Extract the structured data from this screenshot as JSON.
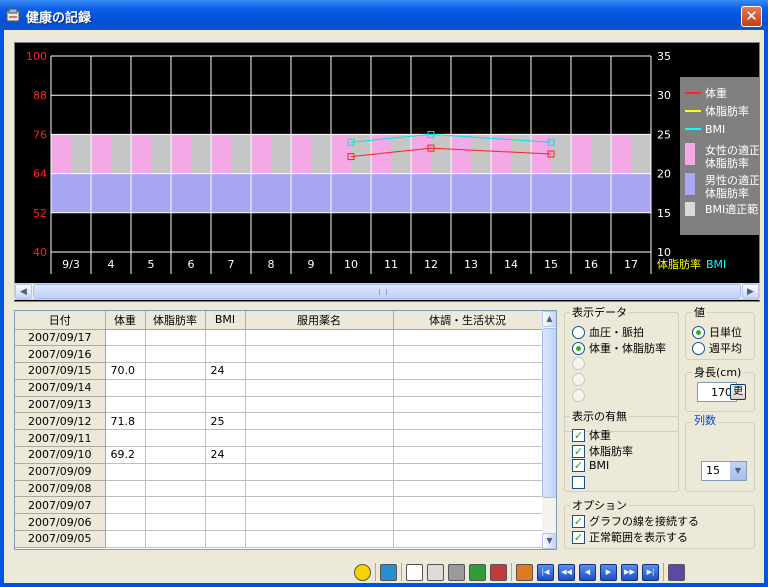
{
  "window": {
    "title": "健康の記録",
    "close_label": "✕"
  },
  "chart": {
    "left_ticks": [
      "100",
      "88",
      "76",
      "64",
      "52",
      "40"
    ],
    "right_ticks": [
      "35",
      "30",
      "25",
      "20",
      "15",
      "10"
    ],
    "x_labels": [
      "9/3",
      "4",
      "5",
      "6",
      "7",
      "8",
      "9",
      "10",
      "11",
      "12",
      "13",
      "14",
      "15",
      "16",
      "17"
    ],
    "bottom_right_label_1": "体脂肪率",
    "bottom_right_label_2": "BMI",
    "legend": [
      {
        "label": "体重",
        "color": "#ff2020",
        "kind": "line"
      },
      {
        "label": "体脂肪率",
        "color": "#ffff00",
        "kind": "line"
      },
      {
        "label": "BMI",
        "color": "#00ffff",
        "kind": "line"
      },
      {
        "label": "女性の適正",
        "label2": "体脂肪率",
        "color": "#f3a9e6",
        "kind": "box"
      },
      {
        "label": "男性の適正",
        "label2": "体脂肪率",
        "color": "#aaa9f3",
        "kind": "box"
      },
      {
        "label": "BMI適正範囲",
        "color": "#d9d9d9",
        "kind": "box"
      }
    ],
    "colors": {
      "weight": "#ff2020",
      "bmi": "#00e5e5",
      "female": "#f3a9e6",
      "male": "#a8a6f0",
      "bmi_band": "#c6c6c6"
    }
  },
  "chart_data": {
    "type": "line",
    "categories": [
      "9/3",
      "4",
      "5",
      "6",
      "7",
      "8",
      "9",
      "10",
      "11",
      "12",
      "13",
      "14",
      "15",
      "16",
      "17"
    ],
    "series": [
      {
        "name": "体重",
        "axis": "left",
        "values": [
          null,
          null,
          null,
          null,
          null,
          null,
          null,
          69.2,
          null,
          71.8,
          null,
          null,
          70.0,
          null,
          null
        ]
      },
      {
        "name": "BMI",
        "axis": "right",
        "values": [
          null,
          null,
          null,
          null,
          null,
          null,
          null,
          24,
          null,
          25,
          null,
          null,
          24,
          null,
          null
        ]
      }
    ],
    "ylim_left": [
      40,
      100
    ],
    "ylim_right": [
      10,
      35
    ],
    "bands": {
      "female_body_fat": [
        64,
        76
      ],
      "male_body_fat": [
        52,
        64
      ],
      "bmi_normal": [
        18.5,
        25
      ]
    },
    "grid": true,
    "legend_position": "right"
  },
  "table": {
    "headers": [
      "日付",
      "体重",
      "体脂肪率",
      "BMI",
      "服用薬名",
      "体調・生活状況"
    ],
    "rows": [
      [
        "2007/09/17",
        "",
        "",
        "",
        "",
        ""
      ],
      [
        "2007/09/16",
        "",
        "",
        "",
        "",
        ""
      ],
      [
        "2007/09/15",
        "70.0",
        "",
        "24",
        "",
        ""
      ],
      [
        "2007/09/14",
        "",
        "",
        "",
        "",
        ""
      ],
      [
        "2007/09/13",
        "",
        "",
        "",
        "",
        ""
      ],
      [
        "2007/09/12",
        "71.8",
        "",
        "25",
        "",
        ""
      ],
      [
        "2007/09/11",
        "",
        "",
        "",
        "",
        ""
      ],
      [
        "2007/09/10",
        "69.2",
        "",
        "24",
        "",
        ""
      ],
      [
        "2007/09/09",
        "",
        "",
        "",
        "",
        ""
      ],
      [
        "2007/09/08",
        "",
        "",
        "",
        "",
        ""
      ],
      [
        "2007/09/07",
        "",
        "",
        "",
        "",
        ""
      ],
      [
        "2007/09/06",
        "",
        "",
        "",
        "",
        ""
      ],
      [
        "2007/09/05",
        "",
        "",
        "",
        "",
        ""
      ]
    ]
  },
  "display_data": {
    "label": "表示データ",
    "opt1": "血圧・脈拍",
    "opt2": "体重・体脂肪率"
  },
  "value_group": {
    "label": "値",
    "opt1": "日単位",
    "opt2": "週平均"
  },
  "height": {
    "label": "身長(cm)",
    "value": "170",
    "btn": "更"
  },
  "show_group": {
    "label": "表示の有無",
    "opt1": "体重",
    "opt2": "体脂肪率",
    "opt3": "BMI"
  },
  "columns": {
    "label": "列数",
    "value": "15"
  },
  "options": {
    "label": "オプション",
    "opt1": "グラフの線を接続する",
    "opt2": "正常範囲を表示する"
  },
  "toolbar": {
    "icons": [
      "lightbulb-icon",
      "mail-icon",
      "document-icon",
      "preview-icon",
      "print-icon",
      "chart-icon",
      "export-icon",
      "home-icon",
      "first-icon",
      "prev-page-icon",
      "prev-icon",
      "next-icon",
      "next-page-icon",
      "last-icon",
      "exit-icon"
    ]
  }
}
